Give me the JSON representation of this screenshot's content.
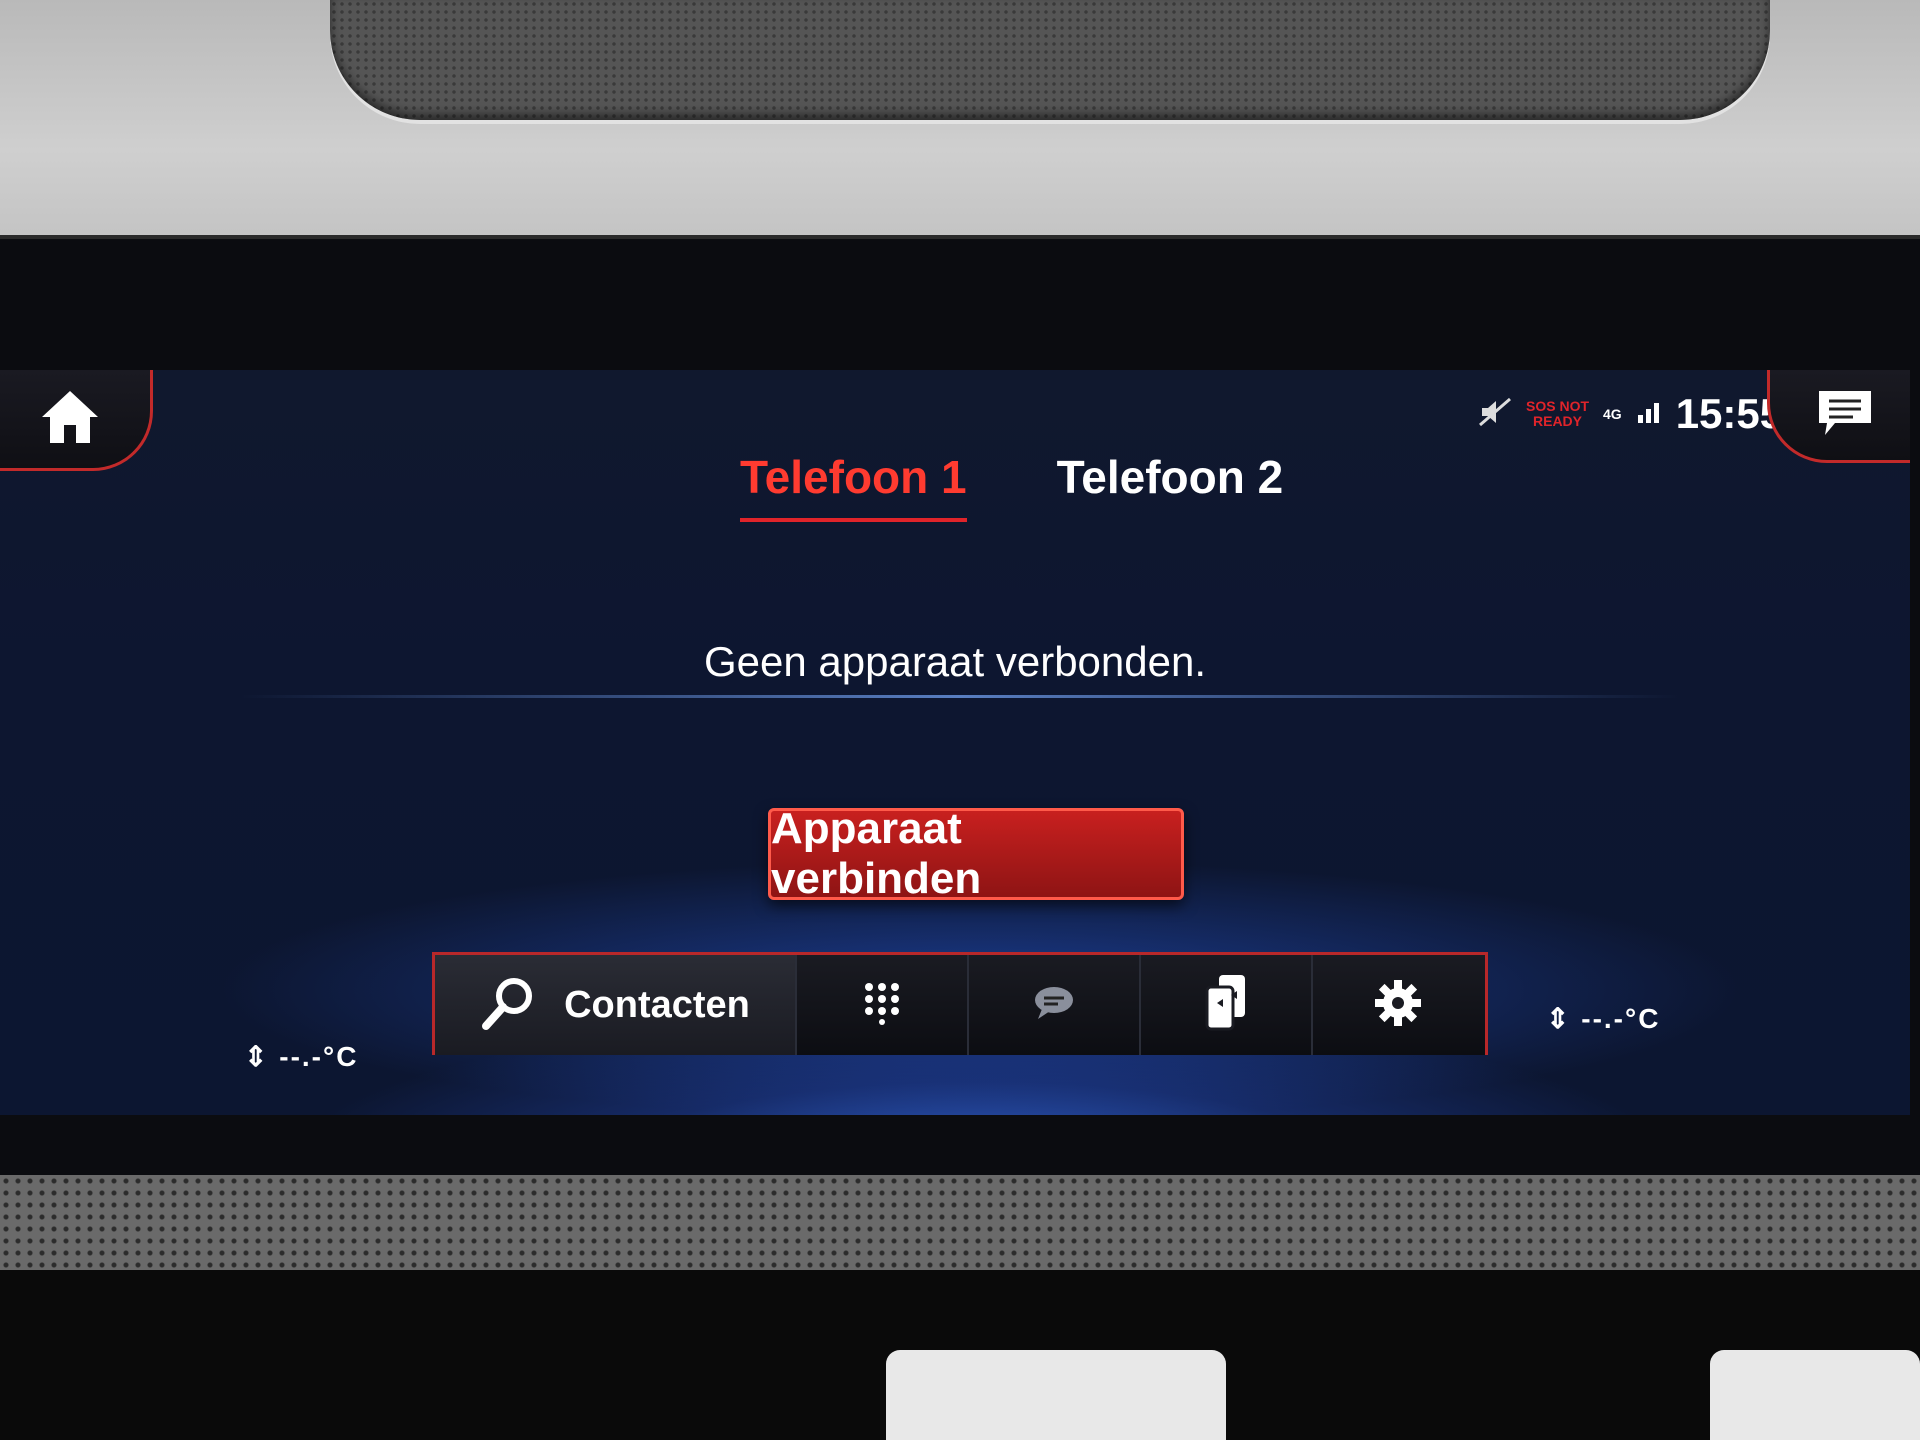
{
  "status": {
    "sos_line1": "SOS NOT",
    "sos_line2": "READY",
    "network": "4G",
    "time": "15:55"
  },
  "tabs": [
    {
      "label": "Telefoon 1",
      "active": true
    },
    {
      "label": "Telefoon 2",
      "active": false
    }
  ],
  "message": "Geen apparaat verbonden.",
  "connect_button": "Apparaat verbinden",
  "dock": {
    "search_label": "Contacten",
    "icons": [
      "search-icon",
      "keypad-icon",
      "message-icon",
      "devices-icon",
      "gear-icon"
    ]
  },
  "climate": {
    "left_temp": "--.-°C",
    "right_temp": "--.-°C"
  },
  "colors": {
    "accent": "#e0242a",
    "background": "#0d1630",
    "glow": "#3c78ff"
  }
}
